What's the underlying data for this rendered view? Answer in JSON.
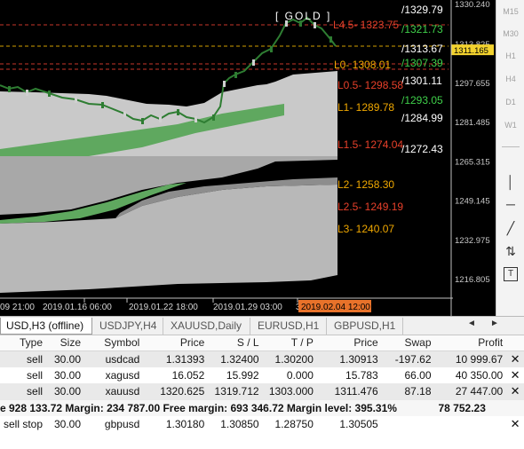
{
  "chart": {
    "symbol_label": "[ GOLD ]",
    "price_axis": [
      {
        "label": "1330.240",
        "price": 1330.24
      },
      {
        "label": "1313.825",
        "price": 1313.825
      },
      {
        "label": "1297.655",
        "price": 1297.655
      },
      {
        "label": "1281.485",
        "price": 1281.485
      },
      {
        "label": "1265.315",
        "price": 1265.315
      },
      {
        "label": "1249.145",
        "price": 1249.145
      },
      {
        "label": "1232.975",
        "price": 1232.975
      },
      {
        "label": "1216.805",
        "price": 1216.805
      }
    ],
    "current_price": {
      "label": "1311.165",
      "price": 1311.165
    },
    "time_axis": [
      "09 21:00",
      "2019.01.16 06:00",
      "2019.01.22 18:00",
      "2019.01.29 03:00",
      "3"
    ],
    "time_axis_highlight": "2019.02.04 12:00",
    "right_labels": [
      {
        "text": "/1329.79",
        "color": "#ffffff"
      },
      {
        "text": "/1321.73",
        "color": "#3fd04a"
      },
      {
        "text": "/1313.67",
        "color": "#ffffff"
      },
      {
        "text": "/1307.39",
        "color": "#3fd04a"
      },
      {
        "text": "/1301.11",
        "color": "#ffffff"
      },
      {
        "text": "/1293.05",
        "color": "#3fd04a"
      },
      {
        "text": "/1284.99",
        "color": "#ffffff"
      },
      {
        "text": "/1272.43",
        "color": "#ffffff"
      }
    ],
    "level_labels": [
      {
        "text": "L4.5- 1323.75",
        "color": "#e8402a"
      },
      {
        "text": "L0- 1308.01",
        "color": "#f0a800"
      },
      {
        "text": "L0.5- 1298.58",
        "color": "#e8402a"
      },
      {
        "text": "L1- 1289.78",
        "color": "#f0a800"
      },
      {
        "text": "L1.5- 1274.04",
        "color": "#e8402a"
      },
      {
        "text": "L2- 1258.30",
        "color": "#f0a800"
      },
      {
        "text": "L2.5- 1249.19",
        "color": "#e8402a"
      },
      {
        "text": "L3- 1240.07",
        "color": "#f0a800"
      }
    ]
  },
  "toolbar": {
    "timeframes": [
      "M15",
      "M30",
      "H1",
      "H4",
      "D1",
      "W1"
    ],
    "tools": [
      "vertical-line-icon",
      "horizontal-line-icon",
      "trendline-icon",
      "arrows-icon",
      "text-label-icon"
    ]
  },
  "tabs": [
    {
      "label": "USD,H3 (offline)",
      "active": true
    },
    {
      "label": "USDJPY,H4",
      "active": false
    },
    {
      "label": "XAUUSD,Daily",
      "active": false
    },
    {
      "label": "EURUSD,H1",
      "active": false
    },
    {
      "label": "GBPUSD,H1",
      "active": false
    }
  ],
  "tab_nav": {
    "left": "◄",
    "right": "►"
  },
  "terminal": {
    "columns": [
      "Type",
      "Size",
      "Symbol",
      "Price",
      "S / L",
      "T / P",
      "Price",
      "Swap",
      "Profit"
    ],
    "rows": [
      [
        "sell",
        "30.00",
        "usdcad",
        "1.31393",
        "1.32400",
        "1.30200",
        "1.30913",
        "-197.62",
        "10 999.67"
      ],
      [
        "sell",
        "30.00",
        "xagusd",
        "16.052",
        "15.992",
        "0.000",
        "15.783",
        "66.00",
        "40 350.00"
      ],
      [
        "sell",
        "30.00",
        "xauusd",
        "1320.625",
        "1319.712",
        "1303.000",
        "1311.476",
        "87.18",
        "27 447.00"
      ]
    ],
    "summary": {
      "equity": "e 928 133.72",
      "margin": "Margin: 234 787.00",
      "free_margin": "Free margin: 693 346.72",
      "margin_level": "Margin level: 395.31%",
      "total": "78 752.23"
    },
    "pending": [
      "sell stop",
      "30.00",
      "gbpusd",
      "1.30180",
      "1.30850",
      "1.28750",
      "1.30505",
      "",
      ""
    ]
  }
}
